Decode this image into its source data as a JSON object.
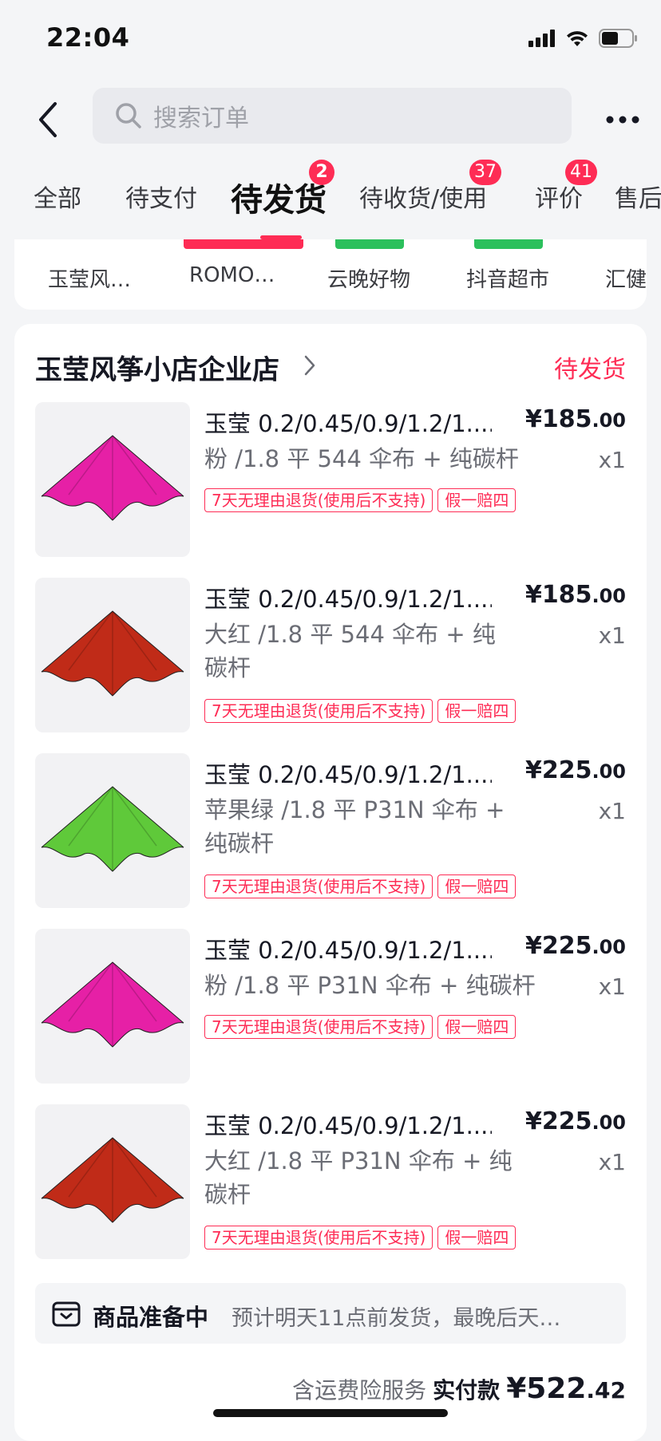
{
  "status_bar": {
    "time": "22:04"
  },
  "header": {
    "search_placeholder": "搜索订单"
  },
  "tabs": [
    {
      "label": "全部"
    },
    {
      "label": "待支付"
    },
    {
      "label": "待发货",
      "badge": "2",
      "active": true
    },
    {
      "label": "待收货/使用",
      "badge": "37"
    },
    {
      "label": "评价",
      "badge": "41"
    },
    {
      "label": "售后"
    }
  ],
  "shops": [
    {
      "name": "玉莹风…"
    },
    {
      "name": "ROMO…"
    },
    {
      "name": "云晚好物"
    },
    {
      "name": "抖音超市"
    },
    {
      "name": "汇健"
    }
  ],
  "order": {
    "store_name": "玉莹风筝小店企业店",
    "status": "待发货",
    "items": [
      {
        "title": "玉莹 0.2/0.45/0.9/1.2/1....",
        "price_int": "¥185",
        "price_dec": ".00",
        "spec": "粉 /1.8 平 544 伞布 + 纯碳杆",
        "qty": "x1",
        "tags": [
          "7天无理由退货(使用后不支持)",
          "假一赔四"
        ],
        "kite_color": "#e620a6"
      },
      {
        "title": "玉莹 0.2/0.45/0.9/1.2/1....",
        "price_int": "¥185",
        "price_dec": ".00",
        "spec": "大红 /1.8 平 544 伞布 + 纯碳杆",
        "qty": "x1",
        "tags": [
          "7天无理由退货(使用后不支持)",
          "假一赔四"
        ],
        "kite_color": "#c02b18"
      },
      {
        "title": "玉莹 0.2/0.45/0.9/1.2/1....",
        "price_int": "¥225",
        "price_dec": ".00",
        "spec": "苹果绿 /1.8 平 P31N 伞布 + 纯碳杆",
        "qty": "x1",
        "tags": [
          "7天无理由退货(使用后不支持)",
          "假一赔四"
        ],
        "kite_color": "#5fc93a"
      },
      {
        "title": "玉莹 0.2/0.45/0.9/1.2/1....",
        "price_int": "¥225",
        "price_dec": ".00",
        "spec": "粉 /1.8 平 P31N 伞布 + 纯碳杆",
        "qty": "x1",
        "tags": [
          "7天无理由退货(使用后不支持)",
          "假一赔四"
        ],
        "kite_color": "#e620a6"
      },
      {
        "title": "玉莹 0.2/0.45/0.9/1.2/1....",
        "price_int": "¥225",
        "price_dec": ".00",
        "spec": "大红 /1.8 平 P31N 伞布 + 纯碳杆",
        "qty": "x1",
        "tags": [
          "7天无理由退货(使用后不支持)",
          "假一赔四"
        ],
        "kite_color": "#c02b18"
      }
    ],
    "prep_title": "商品准备中",
    "prep_desc": "预计明天11点前发货，最晚后天…",
    "total_note": "含运费险服务",
    "total_label": "实付款",
    "total_int": "¥522",
    "total_dec": ".42"
  }
}
